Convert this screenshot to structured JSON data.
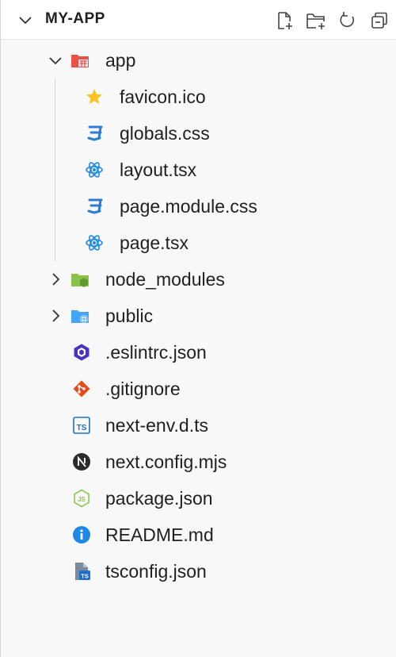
{
  "header": {
    "title": "MY-APP",
    "actions": [
      {
        "icon": "new-file-icon"
      },
      {
        "icon": "new-folder-icon"
      },
      {
        "icon": "refresh-icon"
      },
      {
        "icon": "collapse-all-icon"
      }
    ]
  },
  "tree": {
    "items": [
      {
        "label": "app",
        "icon": "folder-app-icon",
        "type": "folder",
        "expanded": true
      },
      {
        "label": "favicon.ico",
        "icon": "star-icon",
        "type": "file"
      },
      {
        "label": "globals.css",
        "icon": "css-icon",
        "type": "file"
      },
      {
        "label": "layout.tsx",
        "icon": "react-icon",
        "type": "file"
      },
      {
        "label": "page.module.css",
        "icon": "css-icon",
        "type": "file"
      },
      {
        "label": "page.tsx",
        "icon": "react-icon",
        "type": "file"
      },
      {
        "label": "node_modules",
        "icon": "folder-node-icon",
        "type": "folder",
        "expanded": false
      },
      {
        "label": "public",
        "icon": "folder-public-icon",
        "type": "folder",
        "expanded": false
      },
      {
        "label": ".eslintrc.json",
        "icon": "eslint-icon",
        "type": "file"
      },
      {
        "label": ".gitignore",
        "icon": "git-icon",
        "type": "file"
      },
      {
        "label": "next-env.d.ts",
        "icon": "typescript-icon",
        "type": "file"
      },
      {
        "label": "next.config.mjs",
        "icon": "nextjs-icon",
        "type": "file"
      },
      {
        "label": "package.json",
        "icon": "nodejs-icon",
        "type": "file"
      },
      {
        "label": "README.md",
        "icon": "info-icon",
        "type": "file"
      },
      {
        "label": "tsconfig.json",
        "icon": "tsconfig-icon",
        "type": "file"
      }
    ]
  },
  "colors": {
    "folder_app": "#e9524a",
    "folder_node": "#8bc34a",
    "folder_public": "#42a5f5",
    "css": "#2d7dd2",
    "react": "#1e88e5",
    "star": "#f7c325",
    "eslint": "#4b32c3",
    "git": "#e64a19",
    "typescript": "#1e6fd0",
    "nextjs": "#2b2b2b",
    "nodejs": "#8cc84b",
    "info": "#1e88e5"
  }
}
